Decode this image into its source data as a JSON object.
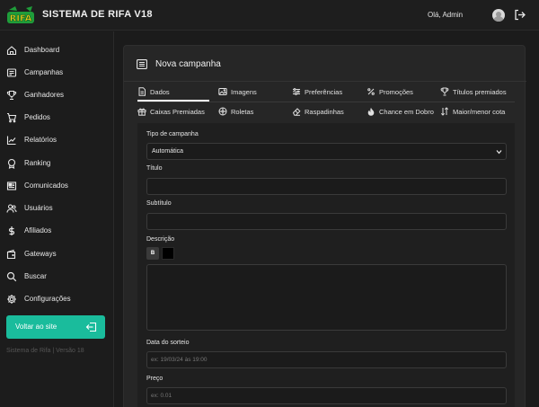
{
  "header": {
    "logo_text": "RIFA",
    "app_title": "SISTEMA DE RIFA V18",
    "greeting": "Olá, Admin",
    "colors": {
      "logo_green": "#1f9d3a",
      "logo_yellow": "#f5d21a"
    }
  },
  "sidebar": {
    "items": [
      {
        "label": "Dashboard",
        "icon": "home-icon"
      },
      {
        "label": "Campanhas",
        "icon": "campaigns-icon"
      },
      {
        "label": "Ganhadores",
        "icon": "trophy-icon"
      },
      {
        "label": "Pedidos",
        "icon": "cart-icon"
      },
      {
        "label": "Relatórios",
        "icon": "chart-icon"
      },
      {
        "label": "Ranking",
        "icon": "medal-icon"
      },
      {
        "label": "Comunicados",
        "icon": "news-icon"
      },
      {
        "label": "Usuários",
        "icon": "users-icon"
      },
      {
        "label": "Afiliados",
        "icon": "dollar-icon"
      },
      {
        "label": "Gateways",
        "icon": "wallet-icon"
      },
      {
        "label": "Buscar",
        "icon": "search-icon"
      },
      {
        "label": "Configurações",
        "icon": "gear-icon"
      }
    ],
    "site_button": "Voltar ao site",
    "version": "Sistema de Rifa | Versão 18",
    "accent": "#1abc9c"
  },
  "card": {
    "title": "Nova campanha"
  },
  "tabs": [
    {
      "label": "Dados",
      "icon": "file-icon",
      "active": true
    },
    {
      "label": "Imagens",
      "icon": "image-icon"
    },
    {
      "label": "Preferências",
      "icon": "sliders-icon"
    },
    {
      "label": "Promoções",
      "icon": "percent-icon"
    },
    {
      "label": "Títulos premiados",
      "icon": "trophy-icon"
    },
    {
      "label": "Caixas Premiadas",
      "icon": "gift-icon"
    },
    {
      "label": "Roletas",
      "icon": "roulette-icon"
    },
    {
      "label": "Raspadinhas",
      "icon": "eraser-icon"
    },
    {
      "label": "Chance em Dobro",
      "icon": "fire-icon"
    },
    {
      "label": "Maior/menor cota",
      "icon": "sort-icon"
    }
  ],
  "form": {
    "tipo_label": "Tipo de campanha",
    "tipo_value": "Automática",
    "titulo_label": "Título",
    "subtitulo_label": "Subtítulo",
    "descricao_label": "Descrição",
    "bold_button": "B",
    "data_label": "Data do sorteio",
    "data_placeholder": "ex: 19/03/24 às 19:00",
    "preco_label": "Preço",
    "preco_placeholder": "ex: 0.01"
  }
}
